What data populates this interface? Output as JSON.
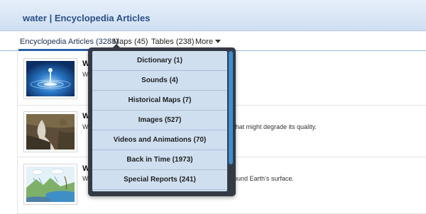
{
  "header": {
    "title": "water | Encyclopedia Articles"
  },
  "tabs": [
    {
      "label": "Encyclopedia Articles (3288)"
    },
    {
      "label": "Maps (45)"
    },
    {
      "label": "Tables (238)"
    },
    {
      "label": "More"
    }
  ],
  "dropdown": {
    "items": [
      {
        "label": "Dictionary (1)"
      },
      {
        "label": "Sounds (4)"
      },
      {
        "label": "Historical Maps (7)"
      },
      {
        "label": "Images (527)"
      },
      {
        "label": "Videos and Animations (70)"
      },
      {
        "label": "Back in Time (1973)"
      },
      {
        "label": "Special Reports (241)"
      }
    ]
  },
  "articles": [
    {
      "title": "W",
      "desc_left": "Wa",
      "desc_right": ""
    },
    {
      "title": "W",
      "desc_left": "Wa",
      "desc_right": "that might degrade its quality."
    },
    {
      "title": "W",
      "desc_left": "Wa",
      "desc_right": "ound Earth’s surface."
    }
  ],
  "colors": {
    "accent": "#2c5fa8",
    "menu_bg": "#cfdff0",
    "menu_frame": "#343a45",
    "scroll_thumb": "#3b8fd3"
  }
}
